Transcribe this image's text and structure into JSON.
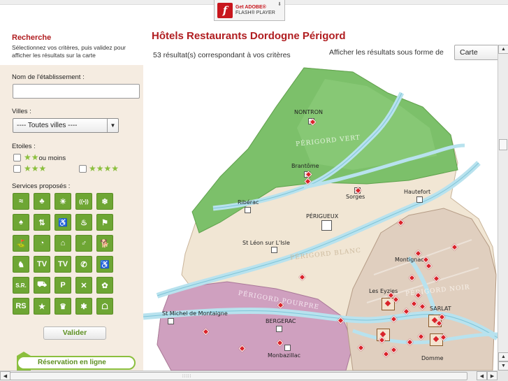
{
  "flash": {
    "line1": "Get ADOBE®",
    "line2": "FLASH® PLAYER"
  },
  "sidebar": {
    "title": "Recherche",
    "description": "Sélectionnez vos critères, puis validez pour afficher les résultats sur la carte",
    "name_label": "Nom de l'établissement :",
    "name_value": "",
    "cities_label": "Villes :",
    "cities_value": "---- Toutes villes ----",
    "stars_label": "Etoiles :",
    "stars_options": [
      {
        "stars": "★★",
        "suffix": "ou moins"
      },
      {
        "stars": "★★★",
        "suffix": ""
      },
      {
        "stars": "★★★★",
        "suffix": ""
      }
    ],
    "services_label": "Services proposés :",
    "services": [
      "pool-icon",
      "garden-icon",
      "sun-terrace-icon",
      "wifi-icon",
      "air-conditioning-icon",
      "playground-icon",
      "elevator-icon",
      "disabled-access-icon",
      "sauna-icon",
      "fitness-icon",
      "minigolf-icon",
      "tennis-icon",
      "home-icon",
      "golf-icon",
      "dog-walk-icon",
      "pets-icon",
      "tv-icon",
      "tv-lounge-icon",
      "phone-icon",
      "accessibility-icon",
      "seminar-room-icon",
      "car-icon",
      "parking-icon",
      "no-smoking-icon",
      "restaurant-icon",
      "logis-icon",
      "logis-label-icon",
      "chateau-icon",
      "bike-icon",
      "gite-icon"
    ],
    "service_glyphs": [
      "≈",
      "♣",
      "☀",
      "((•))",
      "❄",
      "♠",
      "⇅",
      "♿",
      "♨",
      "⚑",
      "⛳",
      "◔",
      "⌂",
      "♂",
      "🐕",
      "♞",
      "TV",
      "TV",
      "✆",
      "♿",
      "S.R.",
      "⛟",
      "P",
      "✕",
      "✿",
      "RS",
      "★",
      "♛",
      "✱",
      "☖"
    ],
    "submit_label": "Valider",
    "reservation_label": "Réservation en ligne"
  },
  "main": {
    "title": "Hôtels Restaurants Dordogne Périgord",
    "result_count": "53 résultat(s) correspondant à vos critères",
    "display_label": "Afficher les résultats sous forme de",
    "display_value": "Carte"
  },
  "map": {
    "regions": [
      "PÉRIGORD VERT",
      "PÉRIGORD BLANC",
      "PÉRIGORD POURPRE",
      "PÉRIGORD NOIR"
    ],
    "towns": [
      "NONTRON",
      "Brantôme",
      "Ribérac",
      "Sorges",
      "Hautefort",
      "PÉRIGUEUX",
      "St Léon sur L'Isle",
      "Montignac",
      "Les Eyzies",
      "SARLAT",
      "St Michel de Montaigne",
      "BERGERAC",
      "Monbazillac",
      "Domme"
    ],
    "colors": {
      "vert": "#7cc06a",
      "blanc": "#f1e6d4",
      "pourpre": "#cfa0bf",
      "noir": "#e0cfbf",
      "river": "#b8e2ee"
    },
    "hotel_marker_count": 53
  }
}
